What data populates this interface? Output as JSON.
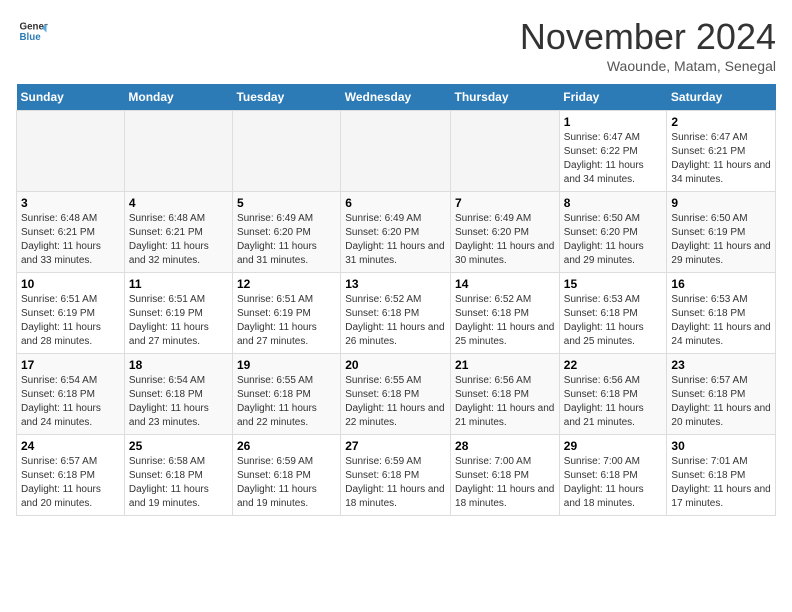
{
  "header": {
    "logo_line1": "General",
    "logo_line2": "Blue",
    "month": "November 2024",
    "location": "Waounde, Matam, Senegal"
  },
  "weekdays": [
    "Sunday",
    "Monday",
    "Tuesday",
    "Wednesday",
    "Thursday",
    "Friday",
    "Saturday"
  ],
  "weeks": [
    [
      {
        "day": "",
        "info": ""
      },
      {
        "day": "",
        "info": ""
      },
      {
        "day": "",
        "info": ""
      },
      {
        "day": "",
        "info": ""
      },
      {
        "day": "",
        "info": ""
      },
      {
        "day": "1",
        "info": "Sunrise: 6:47 AM\nSunset: 6:22 PM\nDaylight: 11 hours and 34 minutes."
      },
      {
        "day": "2",
        "info": "Sunrise: 6:47 AM\nSunset: 6:21 PM\nDaylight: 11 hours and 34 minutes."
      }
    ],
    [
      {
        "day": "3",
        "info": "Sunrise: 6:48 AM\nSunset: 6:21 PM\nDaylight: 11 hours and 33 minutes."
      },
      {
        "day": "4",
        "info": "Sunrise: 6:48 AM\nSunset: 6:21 PM\nDaylight: 11 hours and 32 minutes."
      },
      {
        "day": "5",
        "info": "Sunrise: 6:49 AM\nSunset: 6:20 PM\nDaylight: 11 hours and 31 minutes."
      },
      {
        "day": "6",
        "info": "Sunrise: 6:49 AM\nSunset: 6:20 PM\nDaylight: 11 hours and 31 minutes."
      },
      {
        "day": "7",
        "info": "Sunrise: 6:49 AM\nSunset: 6:20 PM\nDaylight: 11 hours and 30 minutes."
      },
      {
        "day": "8",
        "info": "Sunrise: 6:50 AM\nSunset: 6:20 PM\nDaylight: 11 hours and 29 minutes."
      },
      {
        "day": "9",
        "info": "Sunrise: 6:50 AM\nSunset: 6:19 PM\nDaylight: 11 hours and 29 minutes."
      }
    ],
    [
      {
        "day": "10",
        "info": "Sunrise: 6:51 AM\nSunset: 6:19 PM\nDaylight: 11 hours and 28 minutes."
      },
      {
        "day": "11",
        "info": "Sunrise: 6:51 AM\nSunset: 6:19 PM\nDaylight: 11 hours and 27 minutes."
      },
      {
        "day": "12",
        "info": "Sunrise: 6:51 AM\nSunset: 6:19 PM\nDaylight: 11 hours and 27 minutes."
      },
      {
        "day": "13",
        "info": "Sunrise: 6:52 AM\nSunset: 6:18 PM\nDaylight: 11 hours and 26 minutes."
      },
      {
        "day": "14",
        "info": "Sunrise: 6:52 AM\nSunset: 6:18 PM\nDaylight: 11 hours and 25 minutes."
      },
      {
        "day": "15",
        "info": "Sunrise: 6:53 AM\nSunset: 6:18 PM\nDaylight: 11 hours and 25 minutes."
      },
      {
        "day": "16",
        "info": "Sunrise: 6:53 AM\nSunset: 6:18 PM\nDaylight: 11 hours and 24 minutes."
      }
    ],
    [
      {
        "day": "17",
        "info": "Sunrise: 6:54 AM\nSunset: 6:18 PM\nDaylight: 11 hours and 24 minutes."
      },
      {
        "day": "18",
        "info": "Sunrise: 6:54 AM\nSunset: 6:18 PM\nDaylight: 11 hours and 23 minutes."
      },
      {
        "day": "19",
        "info": "Sunrise: 6:55 AM\nSunset: 6:18 PM\nDaylight: 11 hours and 22 minutes."
      },
      {
        "day": "20",
        "info": "Sunrise: 6:55 AM\nSunset: 6:18 PM\nDaylight: 11 hours and 22 minutes."
      },
      {
        "day": "21",
        "info": "Sunrise: 6:56 AM\nSunset: 6:18 PM\nDaylight: 11 hours and 21 minutes."
      },
      {
        "day": "22",
        "info": "Sunrise: 6:56 AM\nSunset: 6:18 PM\nDaylight: 11 hours and 21 minutes."
      },
      {
        "day": "23",
        "info": "Sunrise: 6:57 AM\nSunset: 6:18 PM\nDaylight: 11 hours and 20 minutes."
      }
    ],
    [
      {
        "day": "24",
        "info": "Sunrise: 6:57 AM\nSunset: 6:18 PM\nDaylight: 11 hours and 20 minutes."
      },
      {
        "day": "25",
        "info": "Sunrise: 6:58 AM\nSunset: 6:18 PM\nDaylight: 11 hours and 19 minutes."
      },
      {
        "day": "26",
        "info": "Sunrise: 6:59 AM\nSunset: 6:18 PM\nDaylight: 11 hours and 19 minutes."
      },
      {
        "day": "27",
        "info": "Sunrise: 6:59 AM\nSunset: 6:18 PM\nDaylight: 11 hours and 18 minutes."
      },
      {
        "day": "28",
        "info": "Sunrise: 7:00 AM\nSunset: 6:18 PM\nDaylight: 11 hours and 18 minutes."
      },
      {
        "day": "29",
        "info": "Sunrise: 7:00 AM\nSunset: 6:18 PM\nDaylight: 11 hours and 18 minutes."
      },
      {
        "day": "30",
        "info": "Sunrise: 7:01 AM\nSunset: 6:18 PM\nDaylight: 11 hours and 17 minutes."
      }
    ]
  ]
}
